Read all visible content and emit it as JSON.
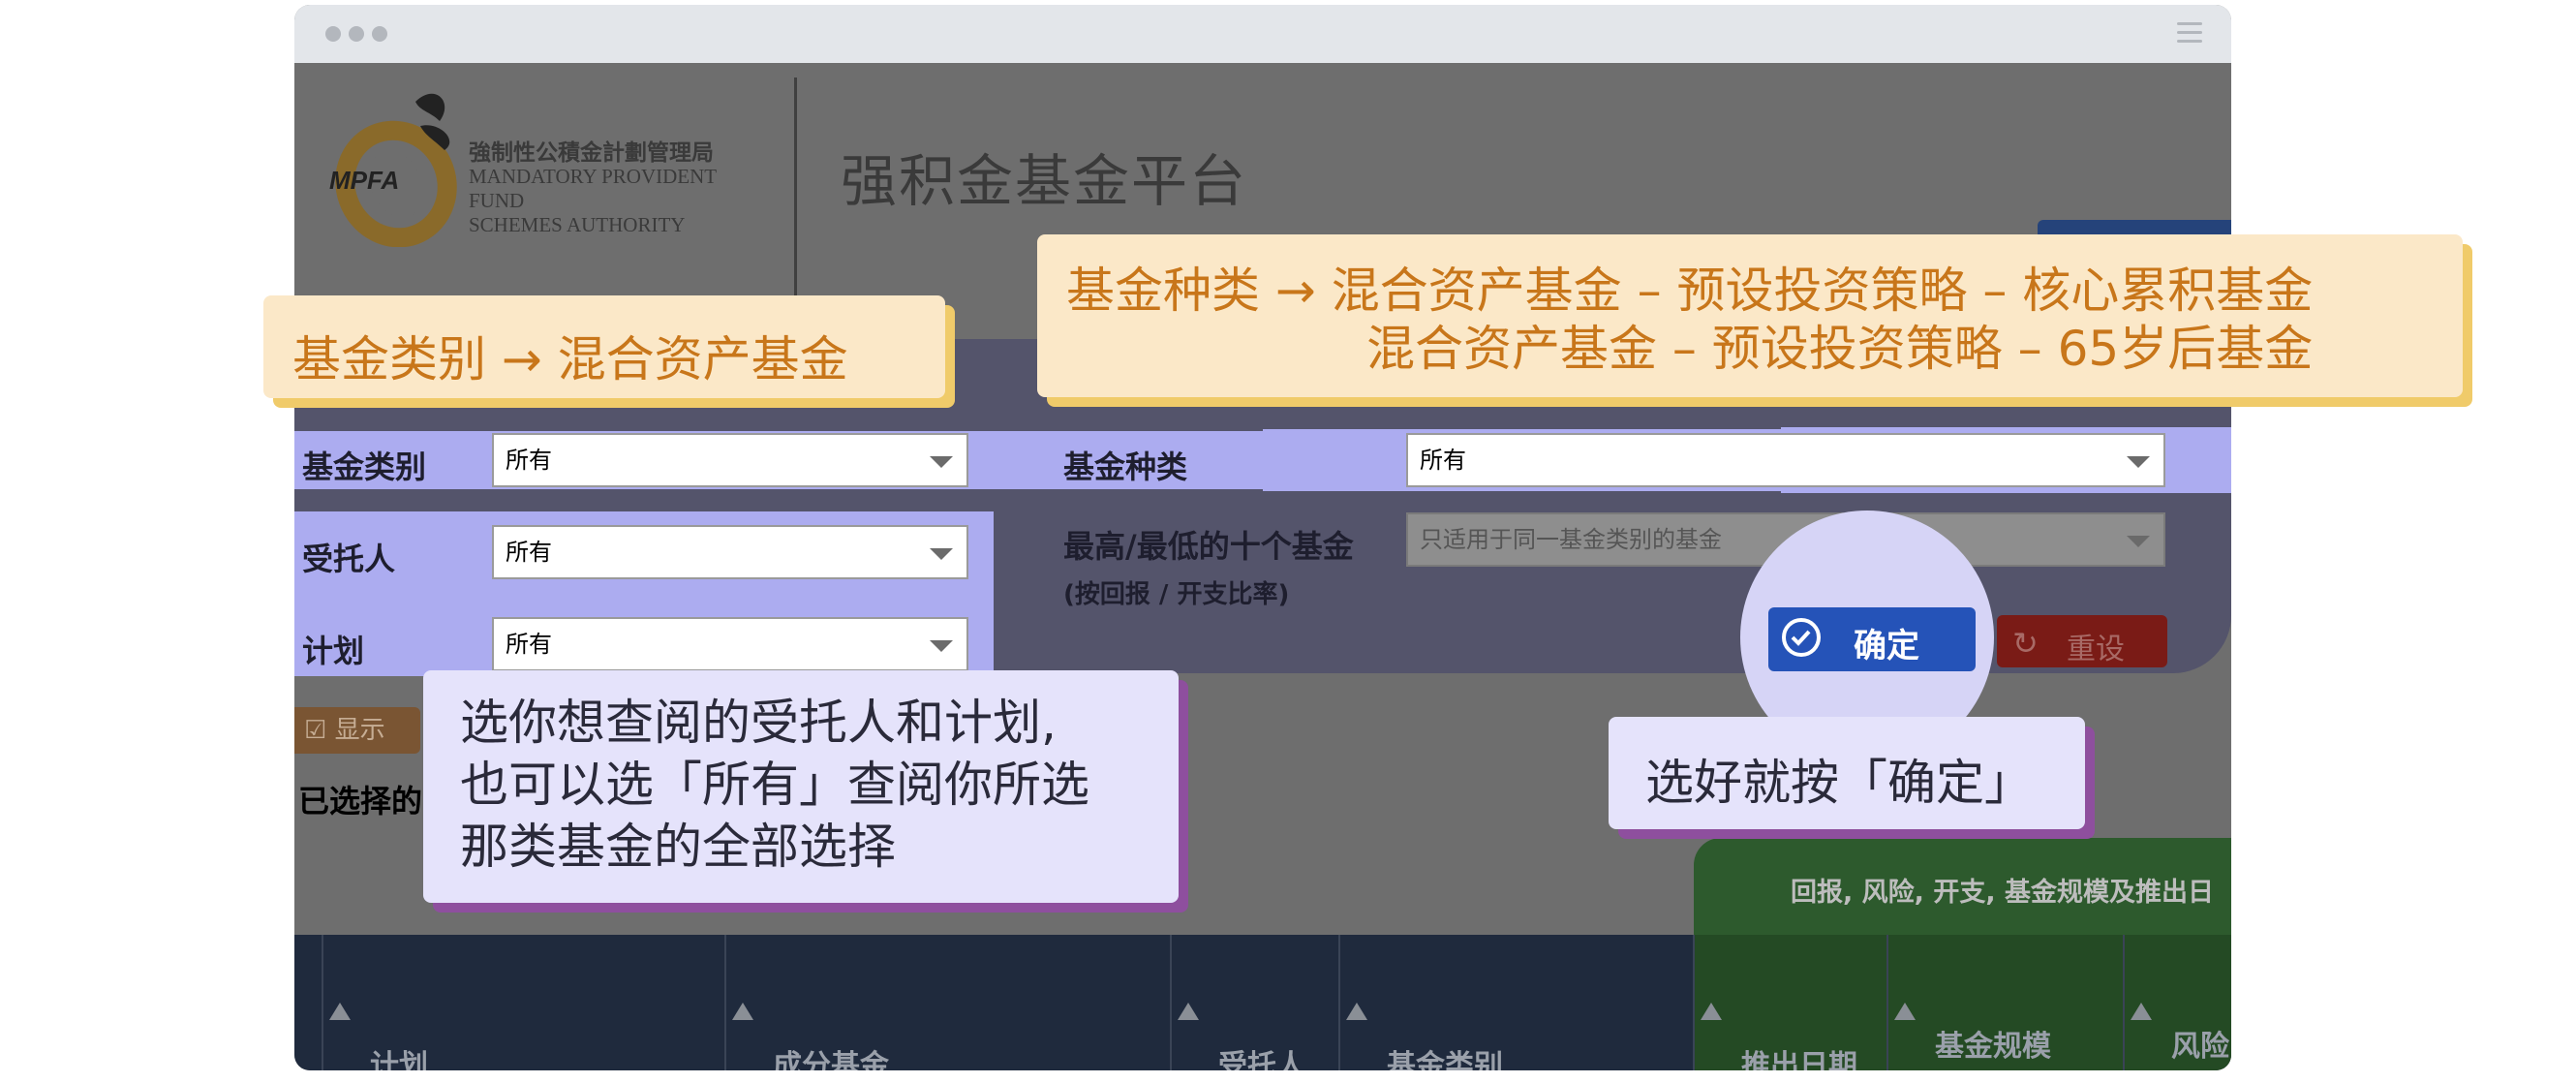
{
  "window": {
    "menu_icon": "hamburger-icon"
  },
  "header": {
    "logo_zh": "強制性公積金計劃管理局",
    "logo_en_line1": "MANDATORY PROVIDENT FUND",
    "logo_en_line2": "SCHEMES AUTHORITY",
    "logo_mark": "MPFA",
    "title": "强积金基金平台"
  },
  "filters": {
    "fund_category": {
      "label": "基金类别",
      "value": "所有"
    },
    "fund_type": {
      "label": "基金种类",
      "value": "所有"
    },
    "trustee": {
      "label": "受托人",
      "value": "所有"
    },
    "scheme": {
      "label": "计划",
      "value": "所有"
    },
    "top_bottom": {
      "label": "最高/最低的十个基金",
      "sublabel": "(按回报 / 开支比率)",
      "placeholder": "只适用于同一基金类别的基金"
    },
    "confirm_label": "确定",
    "reset_label": "重设",
    "show_label": "显示",
    "selected_label": "已选择的"
  },
  "table": {
    "group_header": "回报, 风险, 开支, 基金规模及推出日",
    "columns": [
      "计划",
      "成分基金",
      "受托人",
      "基金类别",
      "推出日期",
      "基金规模",
      "风险"
    ]
  },
  "callouts": {
    "category": "基金类别 → 混合资产基金",
    "type_line1": "基金种类 → 混合资产基金 – 预设投资策略 – 核心累积基金",
    "type_line2": "混合资产基金 – 预设投资策略 – 65岁后基金",
    "trustee_line1": "选你想查阅的受托人和计划,",
    "trustee_line2": "也可以选「所有」查阅你所选",
    "trustee_line3": "那类基金的全部选择",
    "confirm": "选好就按「确定」"
  },
  "colors": {
    "overlay": "#6e6e6e",
    "highlight": "#acacf0",
    "confirm_button": "#2553b8",
    "reset_button": "#7a1b16",
    "callout_yellow": "#fbe8c8",
    "callout_yellow_text": "#c8761a",
    "callout_purple": "#e5e3fb"
  }
}
